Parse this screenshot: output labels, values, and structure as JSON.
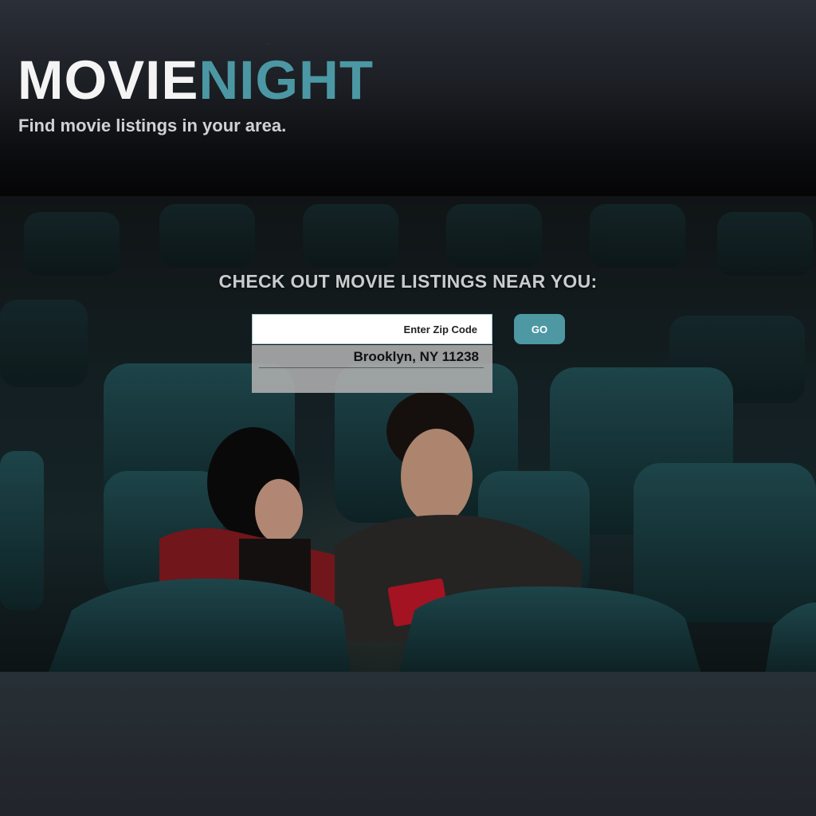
{
  "header": {
    "logo_word_1": "MOVIE",
    "logo_word_2": "NIGHT",
    "logo_icon": "crescent-moon-icon",
    "tagline": "Find movie listings in your area."
  },
  "hero": {
    "heading": "CHECK OUT MOVIE LISTINGS NEAR YOU:",
    "image": "couple-in-movie-theater-photo"
  },
  "search": {
    "placeholder": "Enter Zip Code",
    "value": "",
    "button_label": "GO",
    "suggestions": [
      {
        "label": "Brooklyn, NY 11238"
      }
    ]
  },
  "colors": {
    "brand_accent": "#4b98a4",
    "moon": "#c8801e",
    "logo_light": "#f4f4f4"
  }
}
